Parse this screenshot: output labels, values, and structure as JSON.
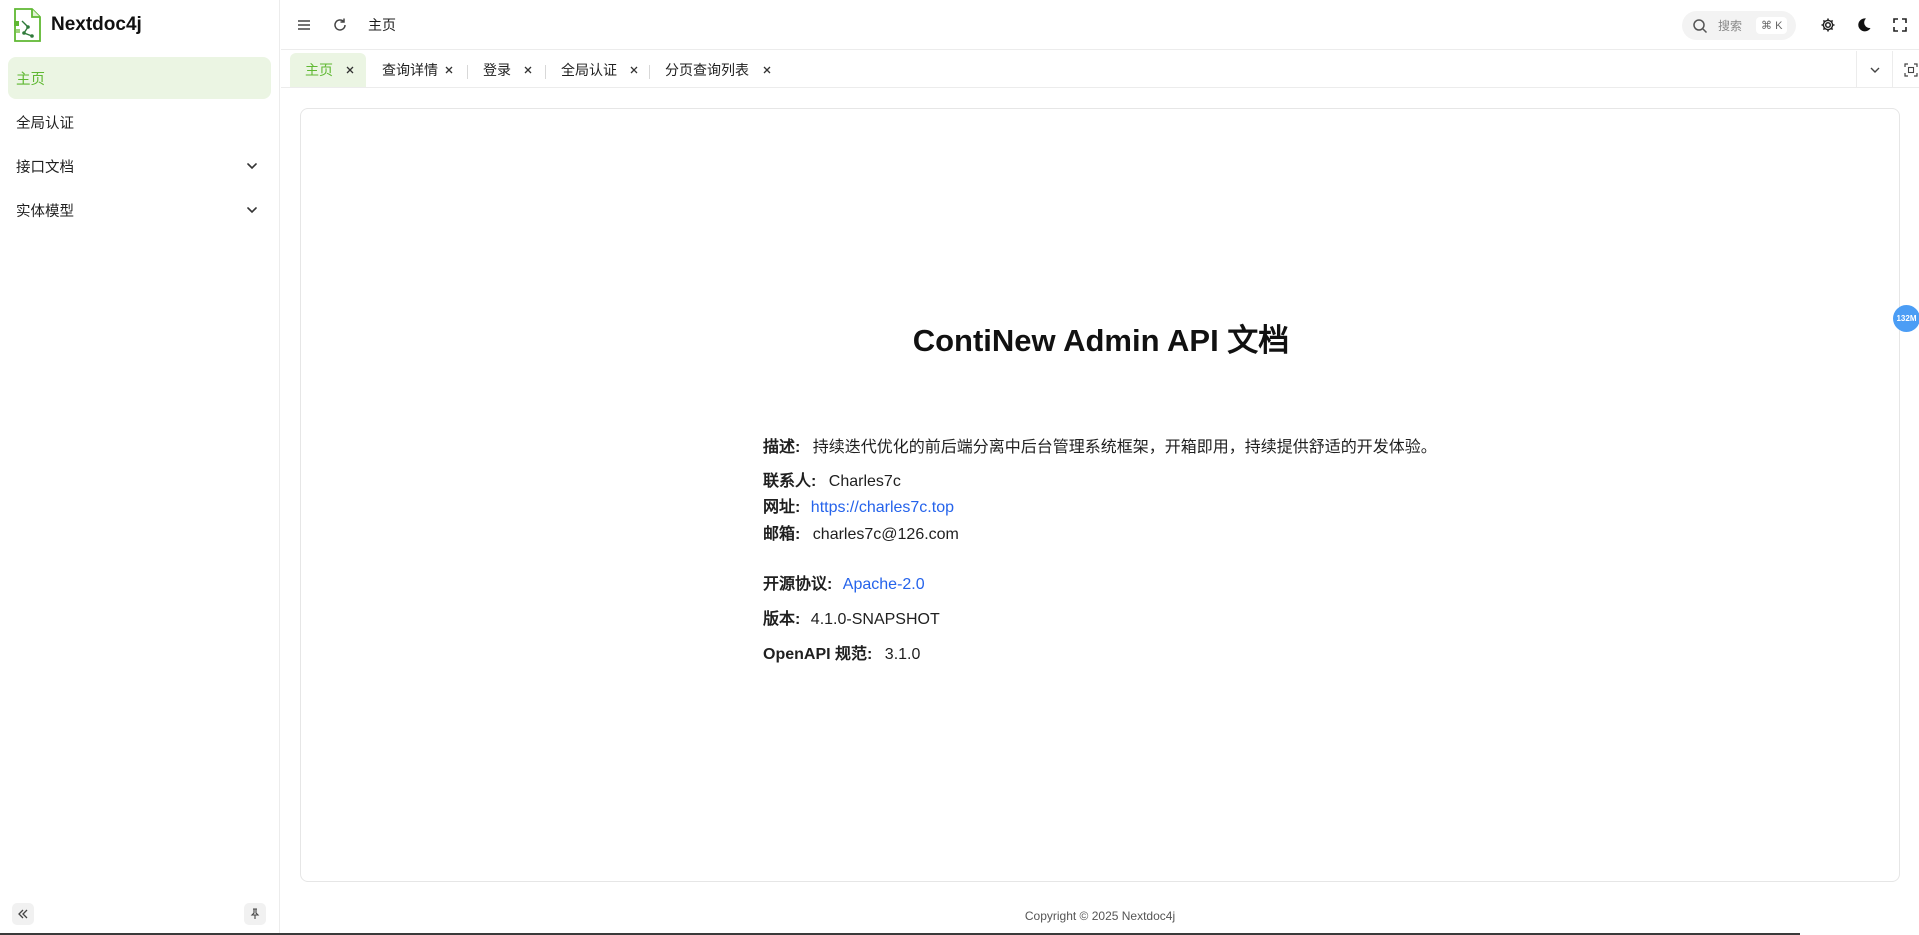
{
  "brand": {
    "name": "Nextdoc4j"
  },
  "sidebar": {
    "items": [
      {
        "label": "主页",
        "active": true,
        "expandable": false
      },
      {
        "label": "全局认证",
        "active": false,
        "expandable": false
      },
      {
        "label": "接口文档",
        "active": false,
        "expandable": true
      },
      {
        "label": "实体模型",
        "active": false,
        "expandable": true
      }
    ]
  },
  "header": {
    "breadcrumb": "主页",
    "search": {
      "placeholder": "搜索",
      "shortcut": "⌘ K"
    }
  },
  "tabs": [
    {
      "label": "主页",
      "active": true
    },
    {
      "label": "查询详情",
      "active": false
    },
    {
      "label": "登录",
      "active": false
    },
    {
      "label": "全局认证",
      "active": false
    },
    {
      "label": "分页查询列表",
      "active": false
    }
  ],
  "doc": {
    "title": "ContiNew Admin API 文档",
    "description_label": "描述:",
    "description": "持续迭代优化的前后端分离中后台管理系统框架，开箱即用，持续提供舒适的开发体验。",
    "contact_label": "联系人:",
    "contact": "Charles7c",
    "url_label": "网址:",
    "url": "https://charles7c.top",
    "email_label": "邮箱:",
    "email": "charles7c@126.com",
    "license_label": "开源协议:",
    "license": "Apache-2.0",
    "version_label": "版本:",
    "version": "4.1.0-SNAPSHOT",
    "openapi_label": "OpenAPI 规范:",
    "openapi": "3.1.0"
  },
  "footer": {
    "copyright": "Copyright © 2025 Nextdoc4j"
  },
  "memory_badge": "132M",
  "colors": {
    "accent": "#5fb832",
    "accent_bg": "#ebf5e3",
    "link": "#2563eb"
  }
}
